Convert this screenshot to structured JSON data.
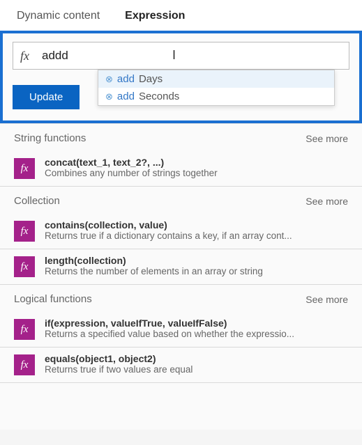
{
  "tabs": {
    "dynamic": "Dynamic content",
    "expression": "Expression"
  },
  "expression": {
    "fx_label": "fx",
    "input_value": "addd",
    "autocomplete": [
      {
        "match": "add",
        "rest": "Days",
        "selected": true
      },
      {
        "match": "add",
        "rest": "Seconds",
        "selected": false
      }
    ],
    "update_label": "Update"
  },
  "see_more_label": "See more",
  "categories": [
    {
      "title": "String functions",
      "items": [
        {
          "sig": "concat(text_1, text_2?, ...)",
          "desc": "Combines any number of strings together"
        }
      ]
    },
    {
      "title": "Collection",
      "items": [
        {
          "sig": "contains(collection, value)",
          "desc": "Returns true if a dictionary contains a key, if an array cont..."
        },
        {
          "sig": "length(collection)",
          "desc": "Returns the number of elements in an array or string"
        }
      ]
    },
    {
      "title": "Logical functions",
      "items": [
        {
          "sig": "if(expression, valueIfTrue, valueIfFalse)",
          "desc": "Returns a specified value based on whether the expressio..."
        },
        {
          "sig": "equals(object1, object2)",
          "desc": "Returns true if two values are equal"
        }
      ]
    }
  ]
}
